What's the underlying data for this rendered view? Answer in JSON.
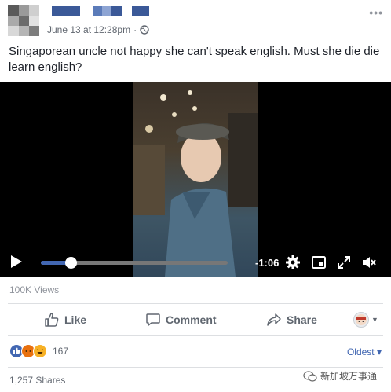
{
  "post": {
    "timestamp": "June 13 at 12:28pm",
    "separator": "·",
    "privacy_icon": "globe-icon",
    "more_label": "•••",
    "caption": "Singaporean uncle not happy she can't speak english. Must she die die learn english?"
  },
  "video": {
    "time_remaining": "-1:06",
    "progress": 0.16,
    "icons": [
      "play-icon",
      "settings-gear-icon",
      "picture-in-picture-icon",
      "fullscreen-icon",
      "volume-icon"
    ]
  },
  "stats": {
    "views": "100K Views",
    "reaction_count": "167",
    "shares": "1,257 Shares"
  },
  "actions": {
    "like": "Like",
    "comment": "Comment",
    "share": "Share"
  },
  "comments": {
    "sort_label": "Oldest ▾"
  },
  "watermark": {
    "text": "新加坡万事通"
  },
  "colors": {
    "brand": "#4267b2",
    "name": "#3b5998",
    "muted": "#90949c"
  }
}
